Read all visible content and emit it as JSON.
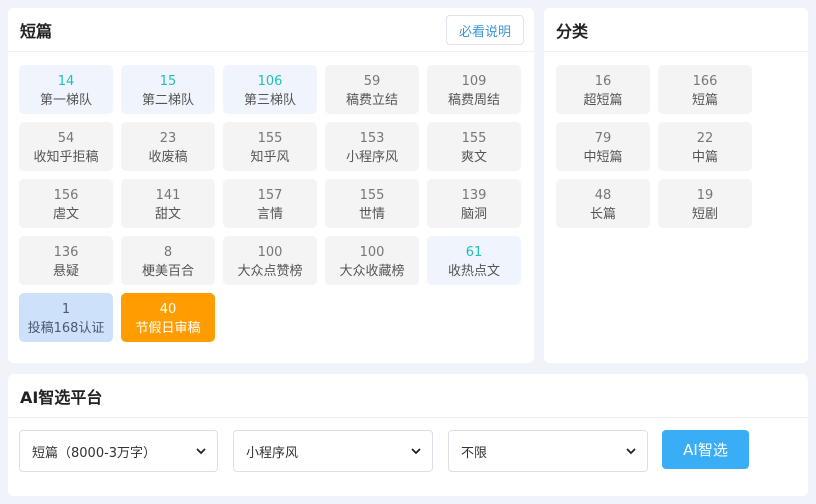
{
  "short": {
    "title": "短篇",
    "guide_label": "必看说明",
    "tiles": [
      {
        "count": "14",
        "label": "第一梯队",
        "style": "hl"
      },
      {
        "count": "15",
        "label": "第二梯队",
        "style": "hl"
      },
      {
        "count": "106",
        "label": "第三梯队",
        "style": "hl"
      },
      {
        "count": "59",
        "label": "稿费立结",
        "style": ""
      },
      {
        "count": "109",
        "label": "稿费周结",
        "style": ""
      },
      {
        "count": "54",
        "label": "收知乎拒稿",
        "style": ""
      },
      {
        "count": "23",
        "label": "收废稿",
        "style": ""
      },
      {
        "count": "155",
        "label": "知乎风",
        "style": ""
      },
      {
        "count": "153",
        "label": "小程序风",
        "style": ""
      },
      {
        "count": "155",
        "label": "爽文",
        "style": ""
      },
      {
        "count": "156",
        "label": "虐文",
        "style": ""
      },
      {
        "count": "141",
        "label": "甜文",
        "style": ""
      },
      {
        "count": "157",
        "label": "言情",
        "style": ""
      },
      {
        "count": "155",
        "label": "世情",
        "style": ""
      },
      {
        "count": "139",
        "label": "脑洞",
        "style": ""
      },
      {
        "count": "136",
        "label": "悬疑",
        "style": ""
      },
      {
        "count": "8",
        "label": "梗美百合",
        "style": ""
      },
      {
        "count": "100",
        "label": "大众点赞榜",
        "style": ""
      },
      {
        "count": "100",
        "label": "大众收藏榜",
        "style": ""
      },
      {
        "count": "61",
        "label": "收热点文",
        "style": "hl"
      },
      {
        "count": "1",
        "label": "投稿168认证",
        "style": "blue"
      },
      {
        "count": "40",
        "label": "节假日审稿",
        "style": "orange"
      }
    ]
  },
  "category": {
    "title": "分类",
    "tiles": [
      {
        "count": "16",
        "label": "超短篇",
        "style": ""
      },
      {
        "count": "166",
        "label": "短篇",
        "style": ""
      },
      {
        "count": "79",
        "label": "中短篇",
        "style": ""
      },
      {
        "count": "22",
        "label": "中篇",
        "style": ""
      },
      {
        "count": "48",
        "label": "长篇",
        "style": ""
      },
      {
        "count": "19",
        "label": "短剧",
        "style": ""
      }
    ]
  },
  "ai": {
    "title": "AI智选平台",
    "selects": [
      {
        "value": "短篇（8000-3万字）"
      },
      {
        "value": "小程序风"
      },
      {
        "value": "不限"
      }
    ],
    "button_label": "AI智选"
  },
  "colors": {
    "page_bg": "#f0f3fa",
    "accent_teal": "#1fbfb8",
    "accent_blue": "#39adf6",
    "accent_orange": "#ff9d00",
    "tile_blue": "#cde1fb"
  },
  "icons": {
    "select_arrow": "chevron-down-icon"
  }
}
